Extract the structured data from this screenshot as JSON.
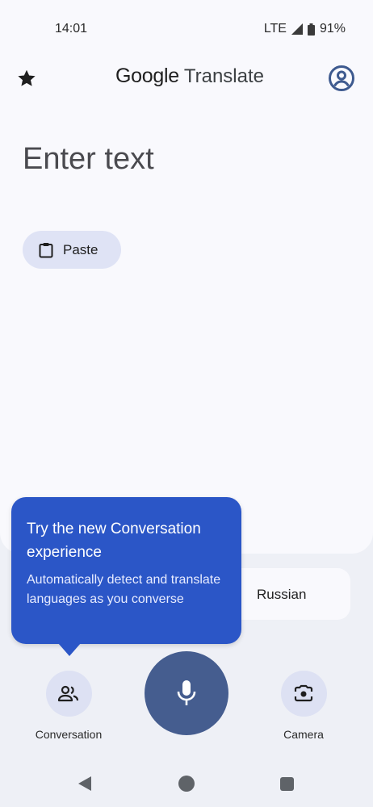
{
  "status_bar": {
    "time": "14:01",
    "network": "LTE",
    "battery": "91%"
  },
  "app_bar": {
    "brand_google": "Google",
    "brand_product": "Translate",
    "icons": [
      "star-icon",
      "account-icon"
    ]
  },
  "input": {
    "placeholder": "Enter text",
    "paste_label": "Paste"
  },
  "language": {
    "target": "Russian"
  },
  "tooltip": {
    "title": "Try the new Conversation experience",
    "body": "Automatically detect and translate languages as you converse"
  },
  "actions": {
    "conversation_label": "Conversation",
    "camera_label": "Camera"
  },
  "colors": {
    "accent": "#2b56c7",
    "mic": "#455d8f",
    "chip": "#dfe3f5"
  }
}
